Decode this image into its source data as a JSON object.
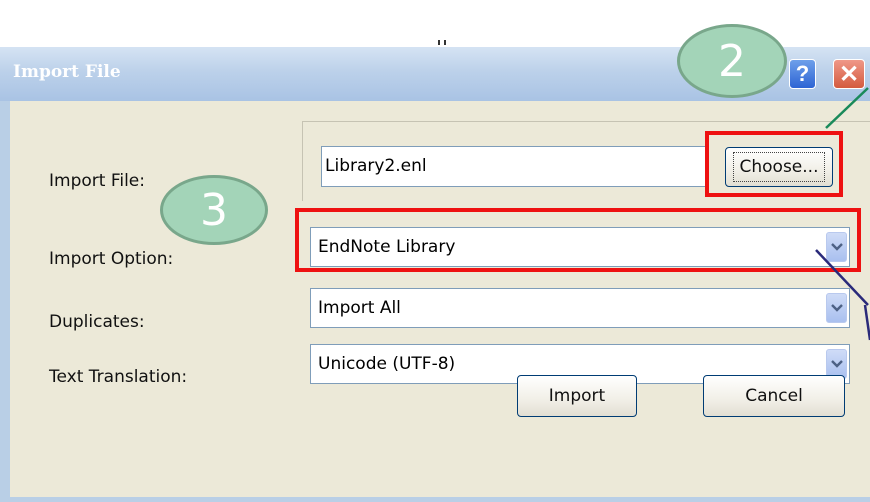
{
  "window": {
    "title": "Import File",
    "help_label": "?",
    "close_label": "✕"
  },
  "form": {
    "import_file_label": "Import File:",
    "import_file_value": "Library2.enl",
    "choose_label": "Choose...",
    "import_option_label": "Import Option:",
    "import_option_value": "EndNote Library",
    "duplicates_label": "Duplicates:",
    "duplicates_value": "Import All",
    "text_translation_label": "Text Translation:",
    "text_translation_value": "Unicode (UTF-8)",
    "import_button": "Import",
    "cancel_button": "Cancel"
  },
  "annotations": {
    "badge_2": "2",
    "badge_3": "3",
    "highlight_color": "#ee1111",
    "badge_color": "#a3d4b8"
  },
  "icons": {
    "dropdown": "chevron-down-icon",
    "help": "help-icon",
    "close": "close-icon"
  }
}
